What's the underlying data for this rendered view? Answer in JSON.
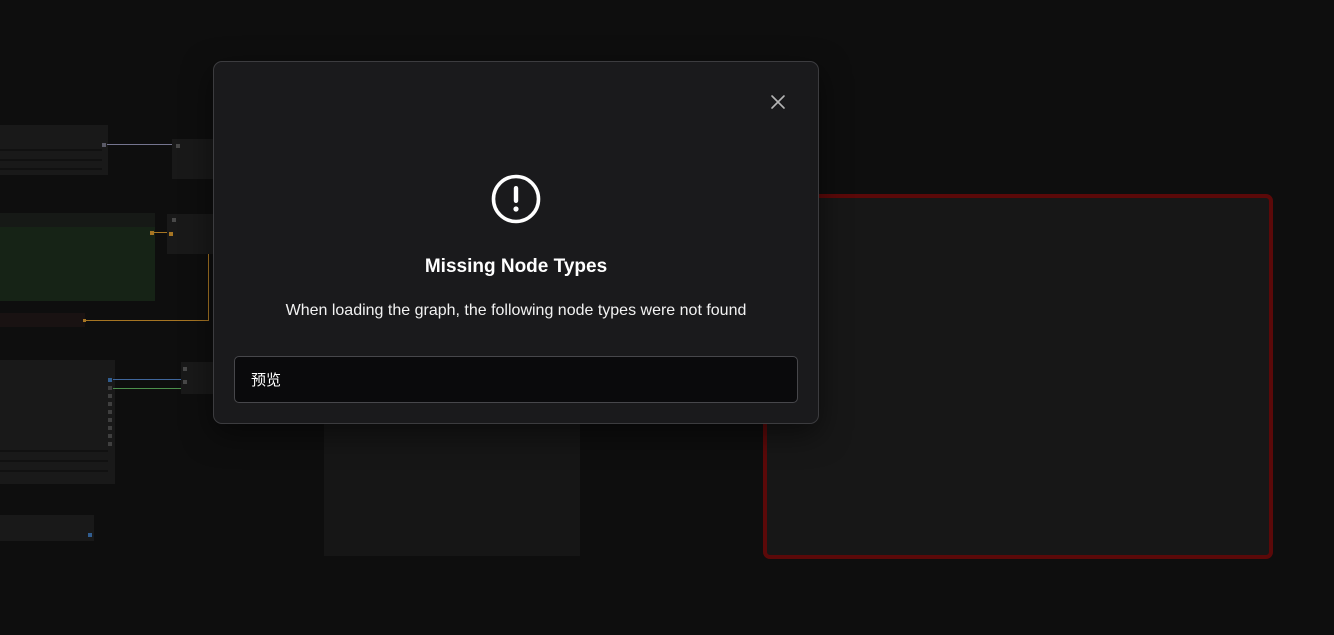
{
  "dialog": {
    "title": "Missing Node Types",
    "description": "When loading the graph, the following node types were not found",
    "missing_nodes": [
      "预览"
    ],
    "close_icon": "close-icon",
    "alert_icon": "exclamation-circle-icon"
  },
  "colors": {
    "background": "#111111",
    "dialog_bg": "#1a1a1c",
    "list_bg": "#0a0a0c",
    "error_border": "#6b0b0b",
    "green_group": "#1a2a1a"
  }
}
